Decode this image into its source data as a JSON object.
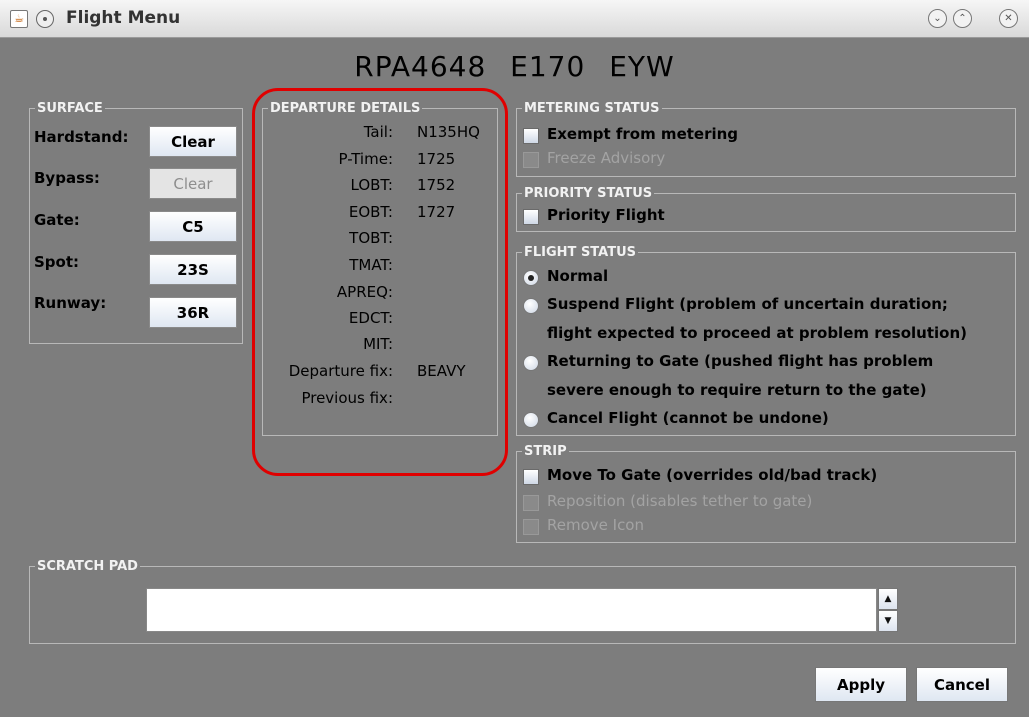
{
  "window": {
    "title": "Flight Menu",
    "java_icon": "java-icon",
    "pin_icon": "pin-icon",
    "minimize_icon": "minimize-icon",
    "maximize_icon": "maximize-icon",
    "close_icon": "close-icon"
  },
  "flight": {
    "callsign": "RPA4648",
    "aircraft": "E170",
    "destination": "EYW"
  },
  "surface": {
    "legend": "SURFACE",
    "rows": [
      {
        "label": "Hardstand:",
        "button": "Clear",
        "enabled": true
      },
      {
        "label": "Bypass:",
        "button": "Clear",
        "enabled": false
      },
      {
        "label": "Gate:",
        "button": "C5",
        "enabled": true
      },
      {
        "label": "Spot:",
        "button": "23S",
        "enabled": true
      },
      {
        "label": "Runway:",
        "button": "36R",
        "enabled": true
      }
    ]
  },
  "departure_details": {
    "legend": "DEPARTURE DETAILS",
    "rows": [
      {
        "label": "Tail:",
        "value": "N135HQ"
      },
      {
        "label": "P-Time:",
        "value": "1725"
      },
      {
        "label": "LOBT:",
        "value": "1752"
      },
      {
        "label": "EOBT:",
        "value": "1727"
      },
      {
        "label": "TOBT:",
        "value": ""
      },
      {
        "label": "TMAT:",
        "value": ""
      },
      {
        "label": "APREQ:",
        "value": ""
      },
      {
        "label": "EDCT:",
        "value": ""
      },
      {
        "label": "MIT:",
        "value": ""
      },
      {
        "label": "Departure fix:",
        "value": "BEAVY"
      },
      {
        "label": "Previous fix:",
        "value": ""
      }
    ]
  },
  "metering_status": {
    "legend": "METERING STATUS",
    "exempt_label": "Exempt from metering",
    "freeze_label": "Freeze Advisory"
  },
  "priority_status": {
    "legend": "PRIORITY STATUS",
    "priority_label": "Priority Flight"
  },
  "flight_status": {
    "legend": "FLIGHT STATUS",
    "options": {
      "normal": "Normal",
      "suspend_line1": "Suspend Flight (problem of uncertain duration;",
      "suspend_line2": "flight expected to proceed at problem resolution)",
      "return_line1": "Returning to Gate (pushed flight has problem",
      "return_line2": "severe enough to require return to the gate)",
      "cancel": "Cancel Flight (cannot be undone)"
    },
    "selected": "Normal"
  },
  "strip": {
    "legend": "STRIP",
    "move_to_gate": "Move To Gate (overrides old/bad track)",
    "reposition": "Reposition (disables tether to gate)",
    "remove_icon": "Remove Icon"
  },
  "scratch_pad": {
    "legend": "SCRATCH PAD",
    "value": ""
  },
  "actions": {
    "apply": "Apply",
    "cancel": "Cancel"
  },
  "colors": {
    "background": "#7d7d7d",
    "highlight": "#e00000"
  }
}
